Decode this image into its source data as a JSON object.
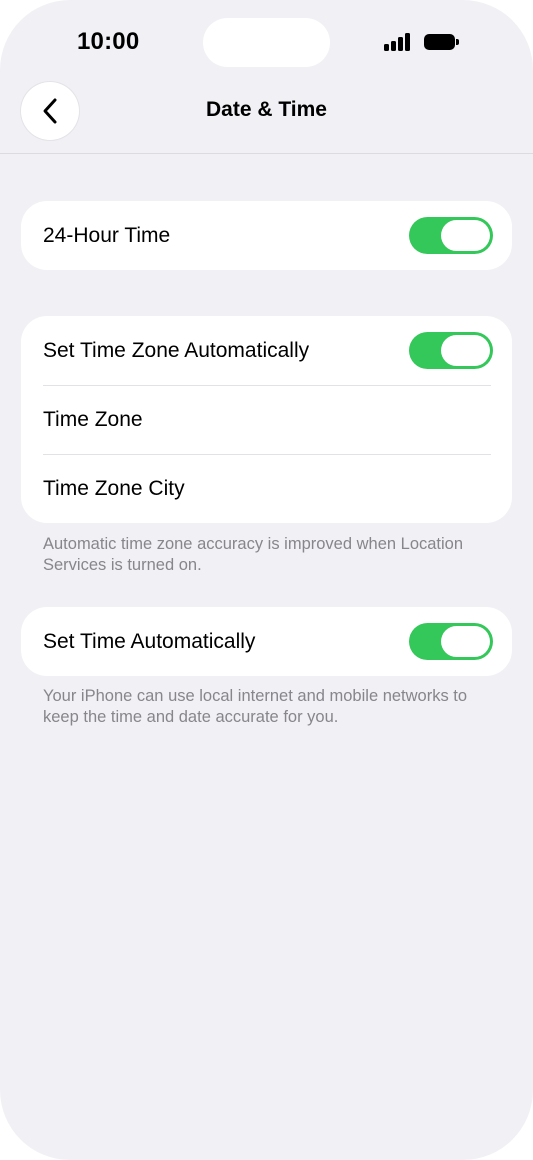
{
  "status_bar": {
    "time": "10:00"
  },
  "nav": {
    "title": "Date & Time",
    "back_icon": "chevron-left-icon"
  },
  "groups": [
    {
      "rows": [
        {
          "label": "24-Hour Time",
          "toggle": true
        }
      ]
    },
    {
      "rows": [
        {
          "label": "Set Time Zone Automatically",
          "toggle": true
        },
        {
          "label": "Time Zone"
        },
        {
          "label": "Time Zone City"
        }
      ],
      "footnote": "Automatic time zone accuracy is improved when Location Services is turned on."
    },
    {
      "rows": [
        {
          "label": "Set Time Automatically",
          "toggle": true
        }
      ],
      "footnote": "Your iPhone can use local internet and mobile networks to keep the time and date accurate for you."
    }
  ],
  "colors": {
    "toggle_on": "#34c759",
    "background": "#f1f0f5"
  }
}
